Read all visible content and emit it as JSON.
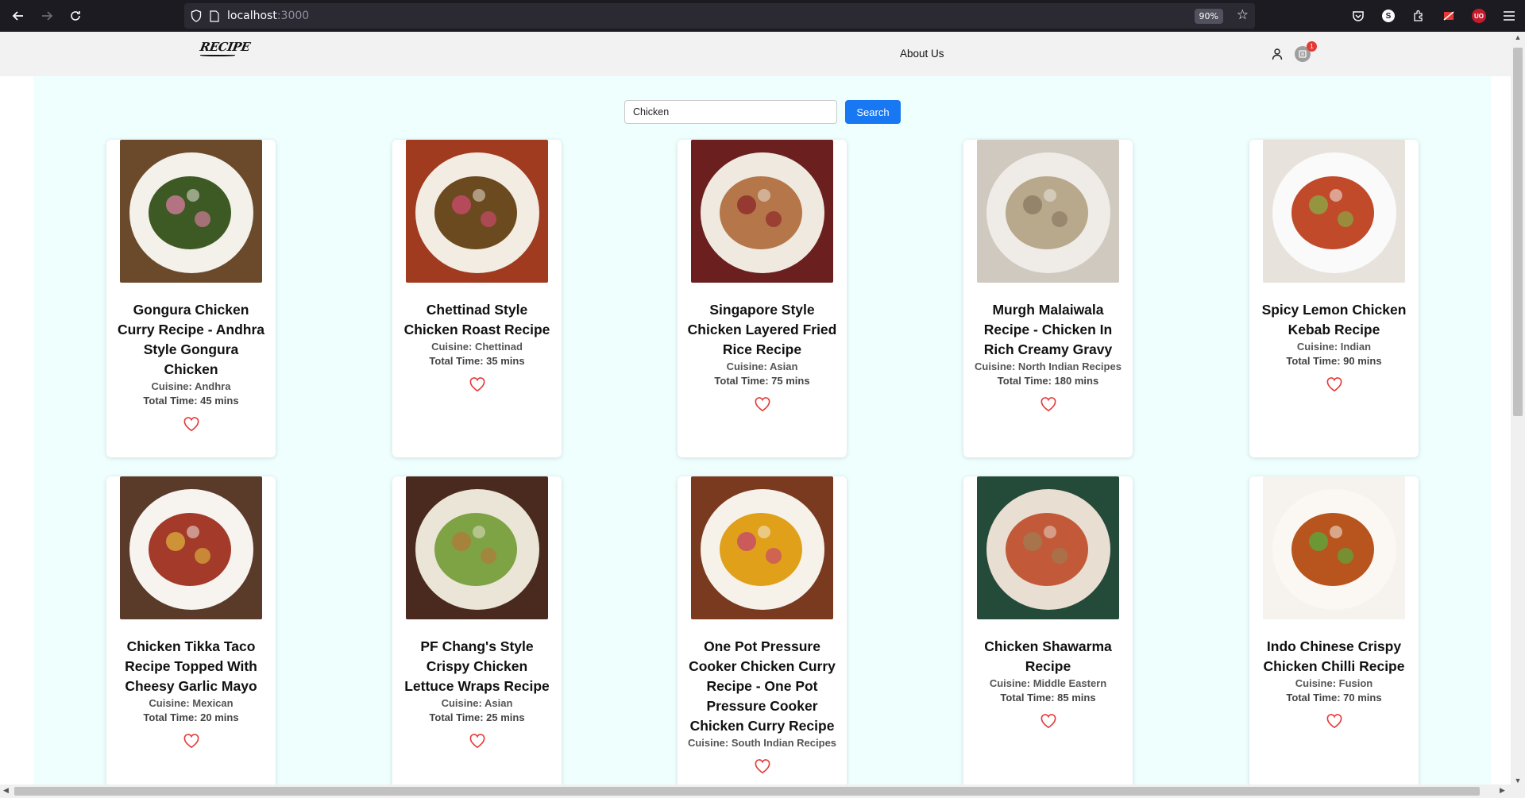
{
  "browser": {
    "url_host": "localhost",
    "url_port": ":3000",
    "zoom": "90%"
  },
  "header": {
    "logo": "RECIPE",
    "about_link": "About Us",
    "cart_count": "1"
  },
  "search": {
    "value": "Chicken",
    "button_label": "Search"
  },
  "recipes": [
    {
      "title": "Gongura Chicken Curry Recipe - Andhra Style Gongura Chicken",
      "cuisine": "Cuisine: Andhra",
      "time": "Total Time: 45 mins"
    },
    {
      "title": "Chettinad Style Chicken Roast Recipe",
      "cuisine": "Cuisine: Chettinad",
      "time": "Total Time: 35 mins"
    },
    {
      "title": "Singapore Style Chicken Layered Fried Rice Recipe",
      "cuisine": "Cuisine: Asian",
      "time": "Total Time: 75 mins"
    },
    {
      "title": "Murgh Malaiwala Recipe - Chicken In Rich Creamy Gravy",
      "cuisine": "Cuisine: North Indian Recipes",
      "time": "Total Time: 180 mins"
    },
    {
      "title": "Spicy Lemon Chicken Kebab Recipe",
      "cuisine": "Cuisine: Indian",
      "time": "Total Time: 90 mins"
    },
    {
      "title": "Chicken Tikka Taco Recipe Topped With Cheesy Garlic Mayo",
      "cuisine": "Cuisine: Mexican",
      "time": "Total Time: 20 mins"
    },
    {
      "title": "PF Chang's Style Crispy Chicken Lettuce Wraps Recipe",
      "cuisine": "Cuisine: Asian",
      "time": "Total Time: 25 mins"
    },
    {
      "title": "One Pot Pressure Cooker Chicken Curry Recipe - One Pot Pressure Cooker Chicken Curry Recipe",
      "cuisine": "Cuisine: South Indian Recipes",
      "time": ""
    },
    {
      "title": "Chicken Shawarma Recipe",
      "cuisine": "Cuisine: Middle Eastern",
      "time": "Total Time: 85 mins"
    },
    {
      "title": "Indo Chinese Crispy Chicken Chilli Recipe",
      "cuisine": "Cuisine: Fusion",
      "time": "Total Time: 70 mins"
    }
  ],
  "colors": {
    "accent": "#1877f2",
    "background": "#effffe",
    "heart": "#e53935"
  }
}
